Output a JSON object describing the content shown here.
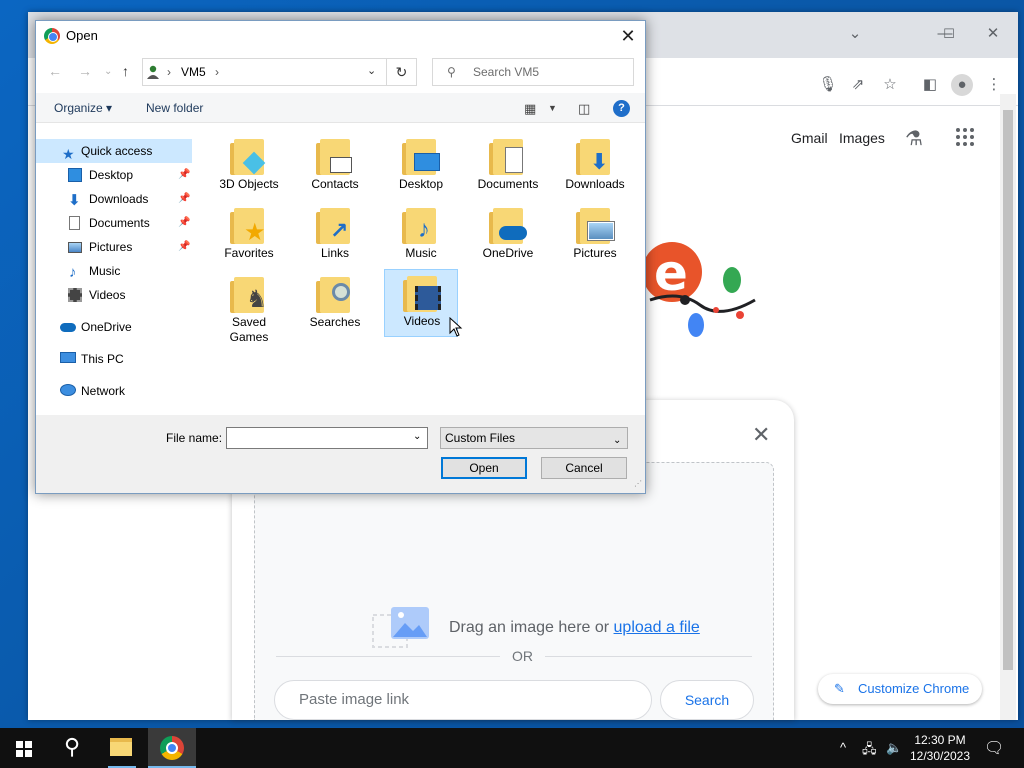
{
  "dialog": {
    "title": "Open",
    "address_crumb": "VM5",
    "search_placeholder": "Search VM5",
    "organize_label": "Organize ▾",
    "new_folder_label": "New folder",
    "file_name_label": "File name:",
    "file_name_value": "",
    "file_type_selected": "Custom Files",
    "open_label": "Open",
    "cancel_label": "Cancel"
  },
  "nav_pane": {
    "quick_access": "Quick access",
    "items": [
      {
        "label": "Desktop",
        "pinned": true
      },
      {
        "label": "Downloads",
        "pinned": true
      },
      {
        "label": "Documents",
        "pinned": true
      },
      {
        "label": "Pictures",
        "pinned": true
      },
      {
        "label": "Music",
        "pinned": false
      },
      {
        "label": "Videos",
        "pinned": false
      }
    ],
    "onedrive": "OneDrive",
    "this_pc": "This PC",
    "network": "Network"
  },
  "folders": [
    {
      "label": "3D Objects",
      "icon": "3d-objects-folder-icon"
    },
    {
      "label": "Contacts",
      "icon": "contacts-folder-icon"
    },
    {
      "label": "Desktop",
      "icon": "desktop-folder-icon"
    },
    {
      "label": "Documents",
      "icon": "documents-folder-icon"
    },
    {
      "label": "Downloads",
      "icon": "downloads-folder-icon"
    },
    {
      "label": "Favorites",
      "icon": "favorites-folder-icon"
    },
    {
      "label": "Links",
      "icon": "links-folder-icon"
    },
    {
      "label": "Music",
      "icon": "music-folder-icon"
    },
    {
      "label": "OneDrive",
      "icon": "onedrive-folder-icon"
    },
    {
      "label": "Pictures",
      "icon": "pictures-folder-icon"
    },
    {
      "label": "Saved Games",
      "icon": "saved-games-folder-icon"
    },
    {
      "label": "Searches",
      "icon": "searches-folder-icon"
    },
    {
      "label": "Videos",
      "icon": "videos-folder-icon",
      "selected": true
    }
  ],
  "chrome": {
    "gmail": "Gmail",
    "images": "Images"
  },
  "lens": {
    "drop_text": "Drag an image here or ",
    "upload_link": "upload a file",
    "or_text": "OR",
    "paste_placeholder": "Paste image link",
    "search_label": "Search"
  },
  "customize_label": "Customize Chrome",
  "taskbar": {
    "time": "12:30 PM",
    "date": "12/30/2023"
  },
  "colors": {
    "selection": "#cce8ff",
    "accent": "#0078d7",
    "chrome_link": "#1a73e8",
    "folder": "#f8d775"
  }
}
